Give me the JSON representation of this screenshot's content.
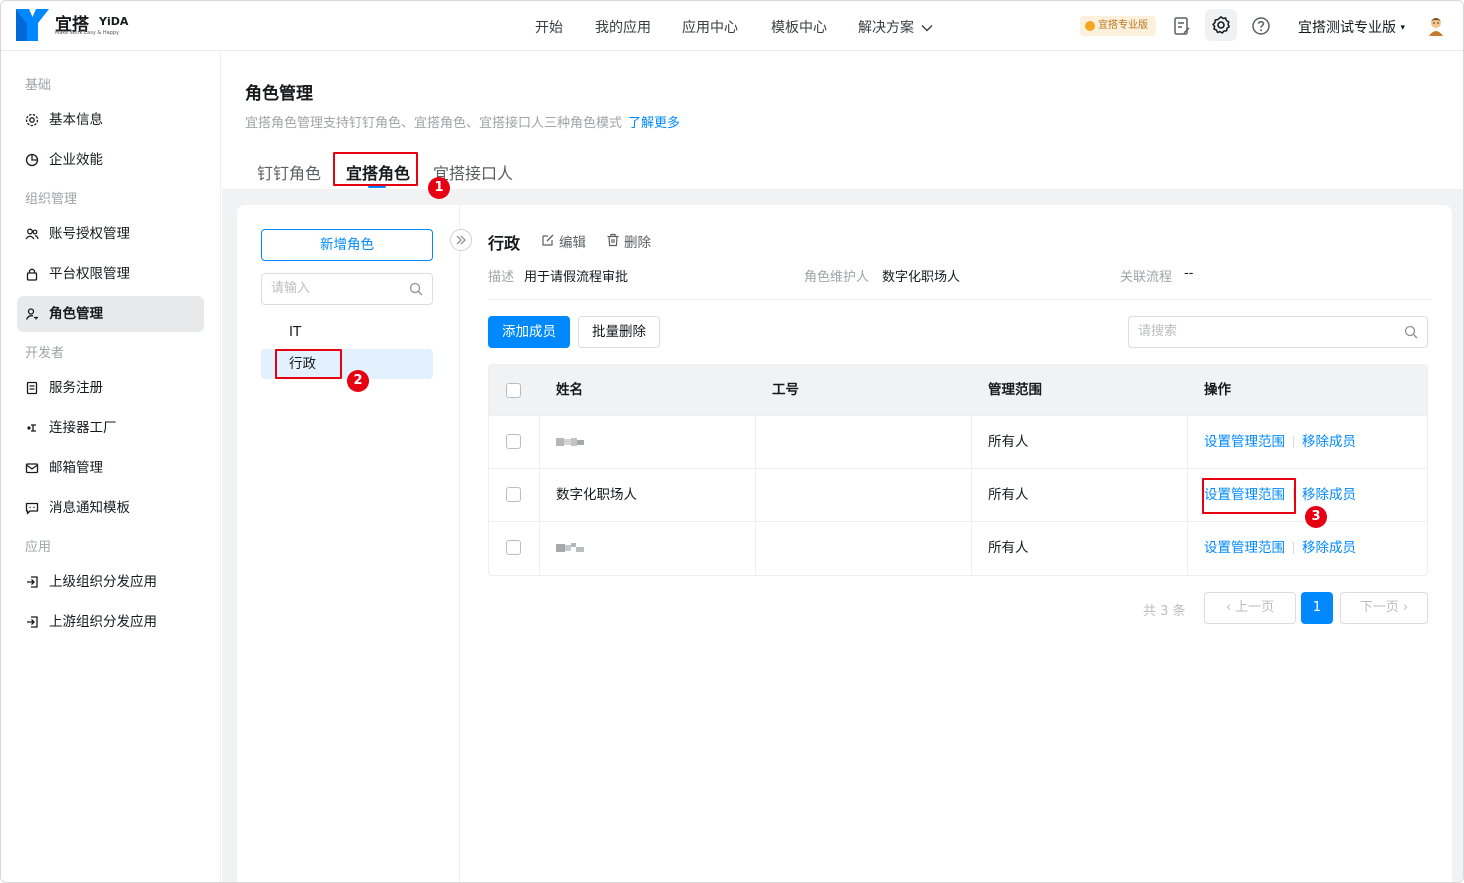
{
  "header": {
    "logo_cn": "宜搭",
    "logo_en": "YiDA",
    "logo_slogan": "Make Work Easy & Happy",
    "nav": [
      "开始",
      "我的应用",
      "应用中心",
      "模板中心",
      "解决方案"
    ],
    "pro_badge": "宜搭专业版",
    "org_name": "宜搭测试专业版",
    "icons": [
      "edit-note-icon",
      "gear-icon",
      "help-icon",
      "avatar-icon"
    ]
  },
  "sidebar": {
    "groups": [
      {
        "label": "基础",
        "items": [
          {
            "label": "基本信息",
            "icon": "gear-icon"
          },
          {
            "label": "企业效能",
            "icon": "pie-chart-icon"
          }
        ]
      },
      {
        "label": "组织管理",
        "items": [
          {
            "label": "账号授权管理",
            "icon": "users-icon"
          },
          {
            "label": "平台权限管理",
            "icon": "lock-icon"
          },
          {
            "label": "角色管理",
            "icon": "user-key-icon",
            "active": true
          }
        ]
      },
      {
        "label": "开发者",
        "items": [
          {
            "label": "服务注册",
            "icon": "document-icon"
          },
          {
            "label": "连接器工厂",
            "icon": "connector-icon"
          },
          {
            "label": "邮箱管理",
            "icon": "mail-icon"
          },
          {
            "label": "消息通知模板",
            "icon": "message-icon"
          }
        ]
      },
      {
        "label": "应用",
        "items": [
          {
            "label": "上级组织分发应用",
            "icon": "login-icon"
          },
          {
            "label": "上游组织分发应用",
            "icon": "login-icon"
          }
        ]
      }
    ]
  },
  "page": {
    "title": "角色管理",
    "desc": "宜搭角色管理支持钉钉角色、宜搭角色、宜搭接口人三种角色模式",
    "learn_more": "了解更多",
    "tabs": [
      "钉钉角色",
      "宜搭角色",
      "宜搭接口人"
    ],
    "active_tab": 1
  },
  "annotations": [
    "1",
    "2",
    "3"
  ],
  "roles": {
    "add_button": "新增角色",
    "search_placeholder": "请输入",
    "items": [
      "IT",
      "行政"
    ],
    "active": 1
  },
  "detail": {
    "role_name": "行政",
    "edit_label": "编辑",
    "delete_label": "删除",
    "desc_label": "描述",
    "desc_value": "用于请假流程审批",
    "maintainer_label": "角色维护人",
    "maintainer_value": "数字化职场人",
    "flow_label": "关联流程",
    "flow_value": "--",
    "add_member": "添加成员",
    "batch_delete": "批量删除",
    "search_placeholder": "请搜索"
  },
  "table": {
    "columns": [
      "姓名",
      "工号",
      "管理范围",
      "操作"
    ],
    "rows": [
      {
        "name": "",
        "name_blurred": true,
        "id": "",
        "scope": "所有人",
        "action1": "设置管理范围",
        "action2": "移除成员"
      },
      {
        "name": "数字化职场人",
        "name_blurred": false,
        "id": "",
        "scope": "所有人",
        "action1": "设置管理范围",
        "action2": "移除成员"
      },
      {
        "name": "",
        "name_blurred": true,
        "id": "",
        "scope": "所有人",
        "action1": "设置管理范围",
        "action2": "移除成员"
      }
    ]
  },
  "pager": {
    "total": "共 3 条",
    "prev": "上一页",
    "current": "1",
    "next": "下一页"
  },
  "colors": {
    "accent": "#0089ff",
    "highlight": "#e60012",
    "active_bg": "#e3f0fd"
  }
}
